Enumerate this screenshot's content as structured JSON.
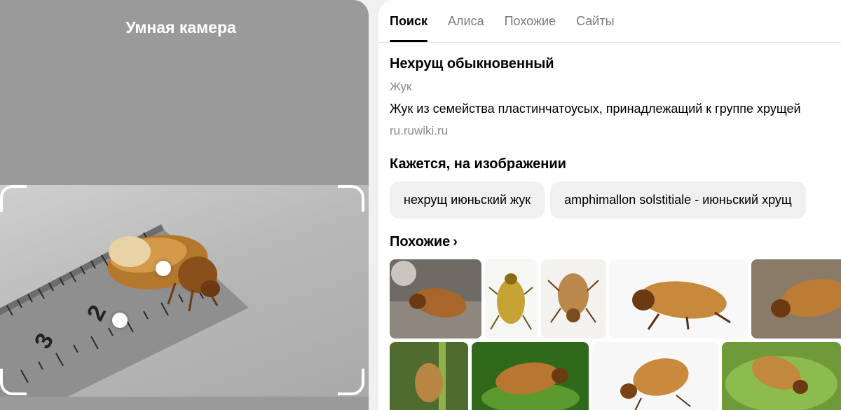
{
  "camera": {
    "title": "Умная камера",
    "ruler_labels": [
      "2",
      "3"
    ]
  },
  "tabs": [
    {
      "label": "Поиск",
      "active": true
    },
    {
      "label": "Алиса",
      "active": false
    },
    {
      "label": "Похожие",
      "active": false
    },
    {
      "label": "Сайты",
      "active": false
    }
  ],
  "entity": {
    "title": "Нехрущ обыкновенный",
    "subtitle": "Жук",
    "description": "Жук из семейства пластинчатоусых, принадлежащий к группе хрущей",
    "source": "ru.ruwiki.ru"
  },
  "seems": {
    "title": "Кажется, на изображении",
    "chips": [
      "нехрущ июньский жук",
      "amphimallon solstitiale - июньский хрущ"
    ]
  },
  "similar": {
    "title": "Похожие",
    "chevron": "›"
  },
  "colors": {
    "camera_bg": "#9a9a9a",
    "chip_bg": "#f0f0f0",
    "beetle": "#b87a2e"
  }
}
